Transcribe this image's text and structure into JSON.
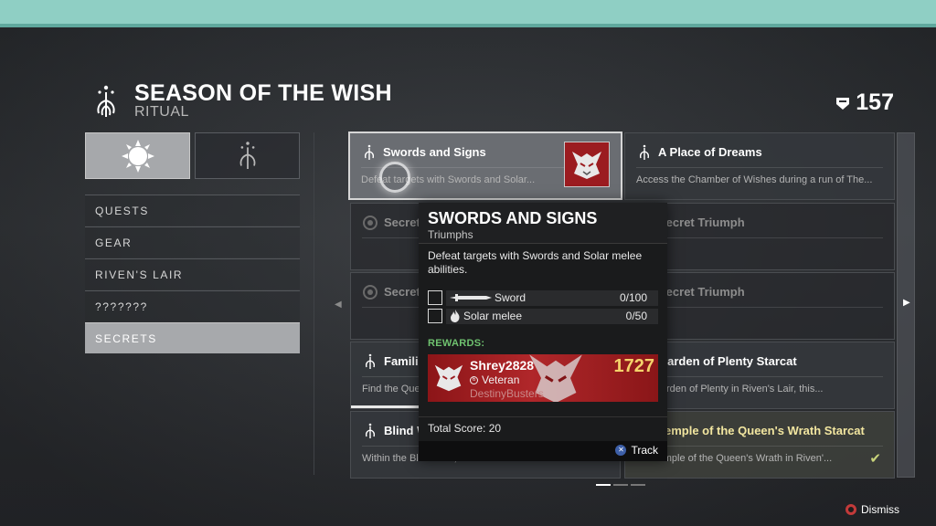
{
  "header": {
    "title": "SEASON OF THE WISH",
    "subtitle": "RITUAL",
    "power_value": "157"
  },
  "category_tabs": [
    {
      "icon": "sun-burst-icon",
      "active": true
    },
    {
      "icon": "wish-sigil-icon",
      "active": false
    }
  ],
  "nav": {
    "items": [
      {
        "label": "QUESTS",
        "active": false
      },
      {
        "label": "GEAR",
        "active": false
      },
      {
        "label": "RIVEN'S LAIR",
        "active": false
      },
      {
        "label": "???????",
        "active": false
      },
      {
        "label": "SECRETS",
        "active": true
      }
    ]
  },
  "cards": {
    "swords": {
      "title": "Swords and Signs",
      "desc": "Defeat targets with Swords and Solar..."
    },
    "place": {
      "title": "A Place of Dreams",
      "desc": "Access the Chamber of Wishes during a run of The..."
    },
    "secret_left_1": {
      "title": "Secret Triumph"
    },
    "secret_right_1": {
      "title": "Secret Triumph"
    },
    "secret_left_2": {
      "title": "Secret Triumph"
    },
    "secret_right_2": {
      "title": "Secret Triumph"
    },
    "familiar": {
      "title": "Familiar",
      "desc": "Find the Que"
    },
    "garden": {
      "title": "Garden of Plenty Starcat",
      "desc": "the Garden of Plenty in Riven's Lair, this..."
    },
    "blind": {
      "title": "Blind W",
      "desc": "Within the Blind Well, use the Starcat to..."
    },
    "temple": {
      "title": "Temple of the Queen's Wrath Starcat",
      "desc": "the Temple of the Queen's Wrath in Riven'..."
    }
  },
  "tooltip": {
    "title": "SWORDS AND SIGNS",
    "category": "Triumphs",
    "description": "Defeat targets with Swords and Solar melee abilities.",
    "objectives": [
      {
        "label": "Sword",
        "count": "0/100",
        "progress": 0
      },
      {
        "label": "Solar melee",
        "count": "0/50",
        "progress": 0
      }
    ],
    "rewards_label": "REWARDS:",
    "reward": {
      "name": "Shrey2828",
      "rank": "Veteran",
      "clan": "DestinyBusters",
      "power": "1727"
    },
    "total_score": "Total Score: 20",
    "track_label": "Track"
  },
  "footer": {
    "dismiss_label": "Dismiss"
  },
  "colors": {
    "top_bar": "#8fcfc4",
    "rewards_green": "#6fc26f",
    "emblem_red": "#9b1c20",
    "complete_yellow": "#f2e6a0"
  }
}
